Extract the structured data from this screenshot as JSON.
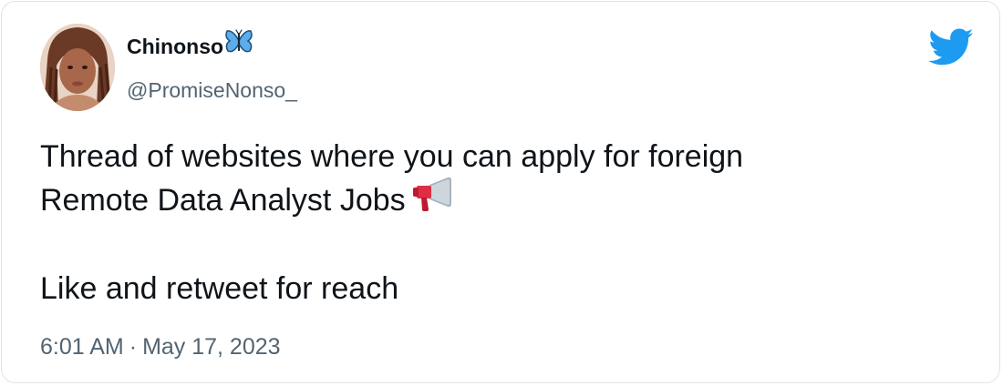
{
  "author": {
    "name": "Chinonso",
    "name_emoji_icon": "butterfly-icon",
    "handle": "@PromiseNonso_",
    "avatar_icon": "profile-photo"
  },
  "platform_icon": "twitter-bird-icon",
  "tweet": {
    "line1": "Thread of websites where you can apply for foreign",
    "line2": "Remote Data Analyst Jobs",
    "line2_emoji_icon": "megaphone-icon",
    "line3": "Like and retweet for reach"
  },
  "meta": {
    "time": "6:01 AM",
    "separator": "·",
    "date": "May 17, 2023"
  },
  "colors": {
    "text_primary": "#0f1419",
    "text_secondary": "#536471",
    "twitter_blue": "#1d9bf0",
    "border": "#dfe3e7"
  }
}
